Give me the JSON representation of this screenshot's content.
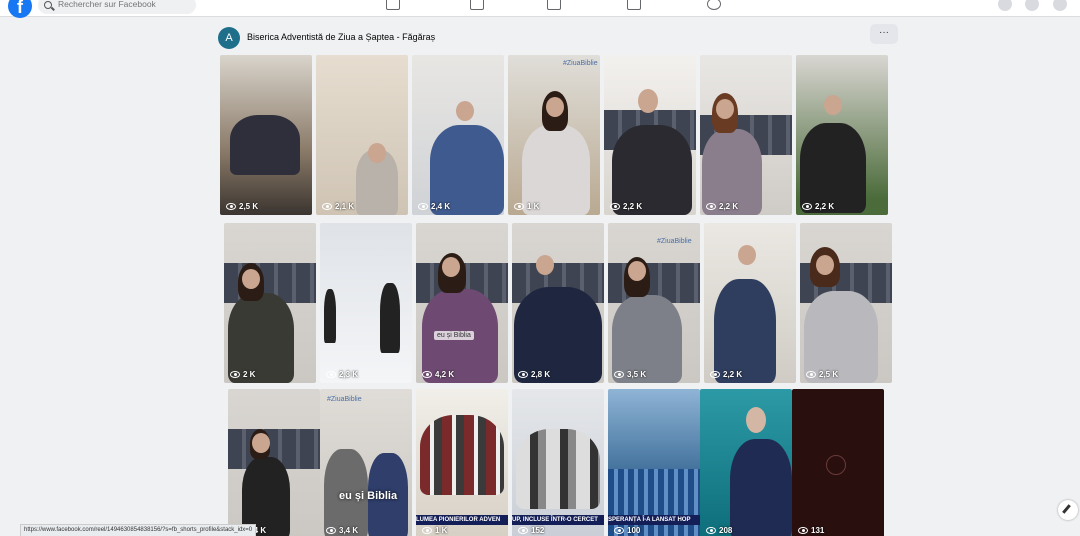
{
  "topbar": {
    "search_placeholder": "Rechercher sur Facebook"
  },
  "page": {
    "name": "Biserica Adventistă de Ziua a Șaptea - Făgăraș",
    "more_label": "···"
  },
  "reels": [
    {
      "views": "2,5 K"
    },
    {
      "views": "2,1 K"
    },
    {
      "views": "2,4 K"
    },
    {
      "views": "1 K"
    },
    {
      "views": "2,2 K"
    },
    {
      "views": "2,2 K"
    },
    {
      "views": "2,2 K"
    },
    {
      "views": "2 K"
    },
    {
      "views": "2,3 K"
    },
    {
      "views": "4,2 K"
    },
    {
      "views": "2,8 K"
    },
    {
      "views": "3,5 K"
    },
    {
      "views": "2,2 K"
    },
    {
      "views": "2,5 K"
    },
    {
      "views": "3,4 K"
    },
    {
      "views": "3,4 K"
    },
    {
      "views": "1 K"
    },
    {
      "views": "152"
    },
    {
      "views": "100"
    },
    {
      "views": "208"
    },
    {
      "views": "131"
    }
  ],
  "overlays": {
    "zua_biblie_1": "#ZiuaBiblie",
    "zua_biblie_2": "#ZiuaBiblie",
    "zua_biblie_3": "#ZiuaBiblie",
    "eu_si_biblia": "eu și Biblia",
    "eu_biblia_small": "eu și Biblia",
    "caption_pionieri": "LUMEA PIONIERILOR ADVEN",
    "caption_cercet": "UP, INCLUSE ÎNTR-O CERCET",
    "caption_speranta": "SPERANȚA Î-A LANSAT HOP"
  },
  "status_url": "https://www.facebook.com/reel/1494630854838156/?s=fb_shorts_profile&stack_idx=0"
}
